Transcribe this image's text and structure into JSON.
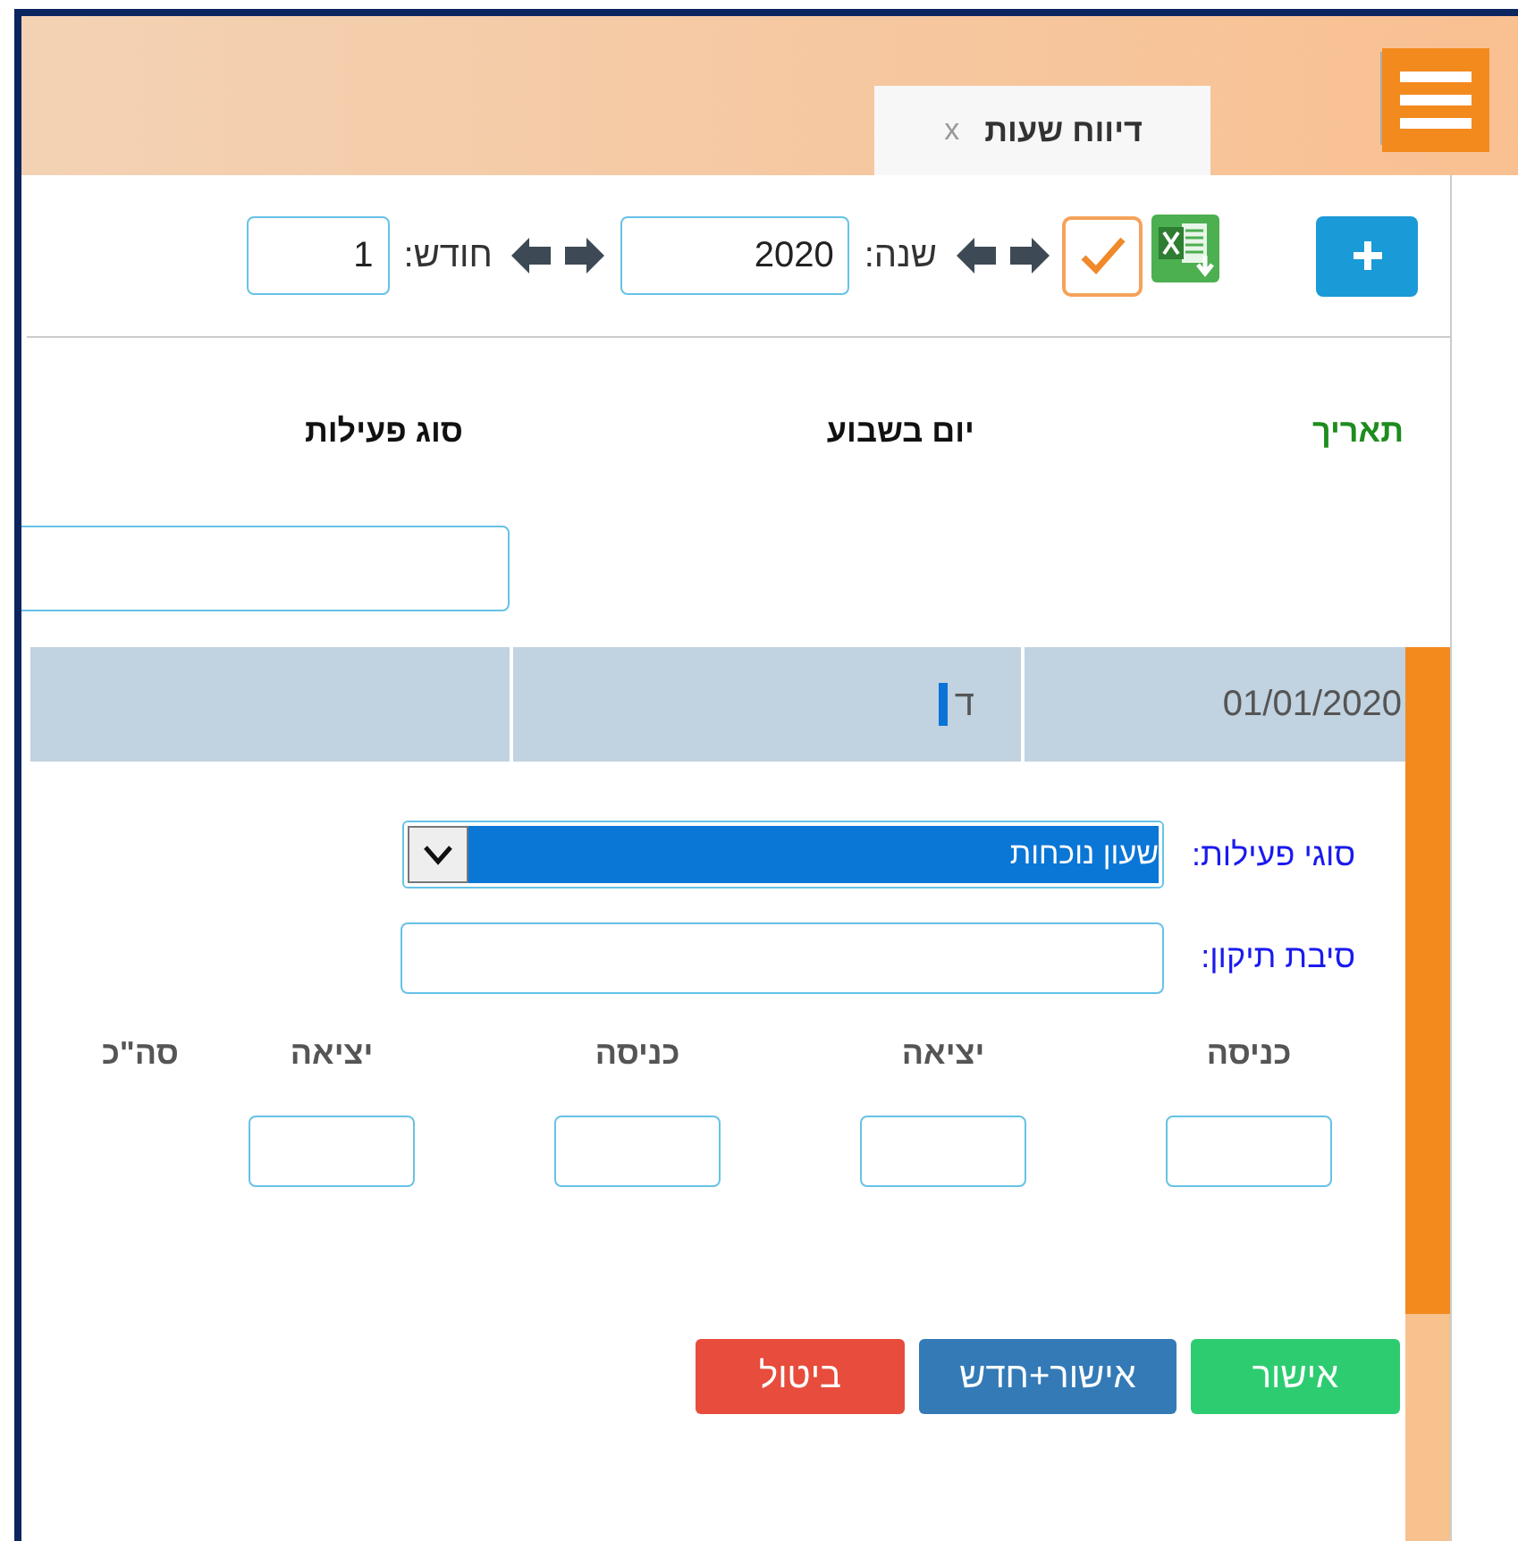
{
  "tab": {
    "title": "דיווח שעות",
    "close": "x"
  },
  "toolbar": {
    "year_label": "שנה:",
    "year": "2020",
    "month_label": "חודש:",
    "month": "1"
  },
  "columns": [
    {
      "label": "תאריך",
      "color": "#1e8c1e"
    },
    {
      "label": "יום בשבוע",
      "color": "#111111"
    },
    {
      "label": "סוג פעילות",
      "color": "#111111"
    }
  ],
  "rows": [
    {
      "cells": [
        "01/01/2020",
        "ד"
      ],
      "selected": true
    }
  ],
  "form": {
    "activity_label": "סוגי פעילות:",
    "activity": "שעון נוכחות",
    "reason_label": "סיבת תיקון:"
  },
  "times": [
    {
      "label": "כניסה",
      "kind": "input"
    },
    {
      "label": "יציאה",
      "kind": "input"
    },
    {
      "label": "כניסה",
      "kind": "input"
    },
    {
      "label": "יציאה",
      "kind": "input"
    },
    {
      "label": "סה\"כ",
      "kind": "total"
    }
  ],
  "buttons": [
    {
      "label": "אישור",
      "kind": "confirm"
    },
    {
      "label": "אישור+חדש",
      "kind": "confirm-new"
    },
    {
      "label": "ביטול",
      "kind": "cancel"
    }
  ]
}
